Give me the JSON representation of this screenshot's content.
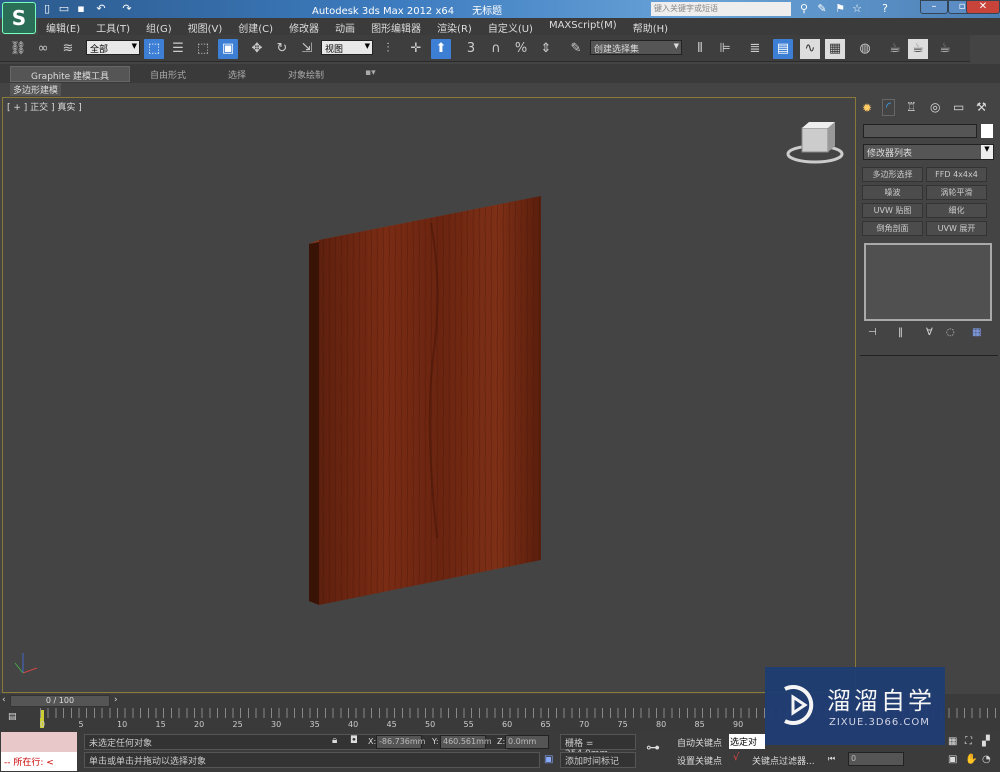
{
  "app": {
    "logo": "S",
    "title": "Autodesk 3ds Max  2012 x64",
    "doc": "无标题",
    "search_placeholder": "键入关键字或短语"
  },
  "menu": [
    "编辑(E)",
    "工具(T)",
    "组(G)",
    "视图(V)",
    "创建(C)",
    "修改器",
    "动画",
    "图形编辑器",
    "渲染(R)",
    "自定义(U)",
    "MAXScript(M)",
    "帮助(H)"
  ],
  "toolbar": {
    "filter": "全部",
    "coord": "视图",
    "selset": "创建选择集",
    "snap3": "3",
    "snap_pct": "%"
  },
  "ribbon": {
    "tabs": [
      "Graphite 建模工具",
      "自由形式",
      "选择",
      "对象绘制"
    ],
    "sub": "多边形建模"
  },
  "viewport": {
    "label": "[ + ] 正交 ] 真实 ]"
  },
  "panel": {
    "modifier_list": "修改器列表",
    "buttons": [
      "多边形选择",
      "FFD 4x4x4",
      "噪波",
      "涡轮平滑",
      "UVW 贴图",
      "细化",
      "倒角剖面",
      "UVW 展开"
    ]
  },
  "timeline": {
    "frame": "0 / 100",
    "ticks": [
      "0",
      "5",
      "10",
      "15",
      "20",
      "25",
      "30",
      "35",
      "40",
      "45",
      "50",
      "55",
      "60",
      "65",
      "70",
      "75",
      "80",
      "85",
      "90"
    ]
  },
  "status": {
    "selection": "未选定任何对象",
    "prompt": "单击或单击并拖动以选择对象",
    "script_label": "所在行:",
    "x_label": "X:",
    "x": "-86.736mm",
    "y_label": "Y:",
    "y": "460.561mm",
    "z_label": "Z:",
    "z": "0.0mm",
    "grid": "栅格 = 254.0mm",
    "add_tag": "添加时间标记",
    "auto_key": "自动关键点",
    "set_key": "设置关键点",
    "selected": "选定对象",
    "key_filter": "关键点过滤器...",
    "frame_field": "0"
  },
  "watermark": {
    "name": "溜溜自学",
    "url": "ZIXUE.3D66.COM"
  },
  "colors": {
    "wood": "#6b2410",
    "viewport": "#444444",
    "accent": "#3d7fd4"
  }
}
